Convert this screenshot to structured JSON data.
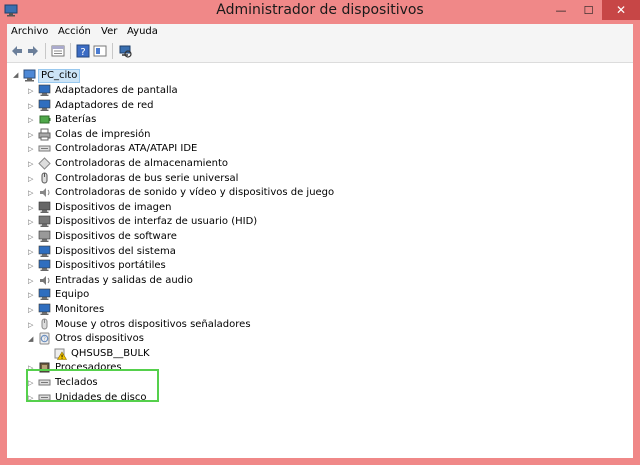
{
  "window": {
    "title": "Administrador de dispositivos",
    "close_glyph": "✕",
    "minimize_glyph": "—",
    "maximize_glyph": "☐"
  },
  "menubar": {
    "items": [
      "Archivo",
      "Acción",
      "Ver",
      "Ayuda"
    ]
  },
  "toolbar": {
    "buttons": [
      "back-icon",
      "forward-icon",
      "properties-view-icon",
      "help-icon",
      "show-hidden-icon",
      "scan-hardware-icon"
    ]
  },
  "tree": {
    "root": {
      "label": "PC_cito",
      "expanded": true
    },
    "categories": [
      {
        "label": "Adaptadores de pantalla",
        "icon": "display-adapter-icon"
      },
      {
        "label": "Adaptadores de red",
        "icon": "network-adapter-icon"
      },
      {
        "label": "Baterías",
        "icon": "battery-icon"
      },
      {
        "label": "Colas de impresión",
        "icon": "printer-icon"
      },
      {
        "label": "Controladoras ATA/ATAPI IDE",
        "icon": "ide-controller-icon"
      },
      {
        "label": "Controladoras de almacenamiento",
        "icon": "storage-controller-icon"
      },
      {
        "label": "Controladoras de bus serie universal",
        "icon": "usb-icon"
      },
      {
        "label": "Controladoras de sonido y vídeo y dispositivos de juego",
        "icon": "sound-icon"
      },
      {
        "label": "Dispositivos de imagen",
        "icon": "camera-icon"
      },
      {
        "label": "Dispositivos de interfaz de usuario (HID)",
        "icon": "hid-icon"
      },
      {
        "label": "Dispositivos de software",
        "icon": "software-device-icon"
      },
      {
        "label": "Dispositivos del sistema",
        "icon": "system-device-icon"
      },
      {
        "label": "Dispositivos portátiles",
        "icon": "portable-device-icon"
      },
      {
        "label": "Entradas y salidas de audio",
        "icon": "audio-io-icon"
      },
      {
        "label": "Equipo",
        "icon": "computer-icon"
      },
      {
        "label": "Monitores",
        "icon": "monitor-icon"
      },
      {
        "label": "Mouse y otros dispositivos señaladores",
        "icon": "mouse-icon"
      },
      {
        "label": "Otros dispositivos",
        "icon": "other-devices-icon",
        "expanded": true,
        "children": [
          {
            "label": "QHSUSB__BULK",
            "icon": "warning-device-icon"
          }
        ]
      },
      {
        "label": "Procesadores",
        "icon": "processor-icon"
      },
      {
        "label": "Teclados",
        "icon": "keyboard-icon"
      },
      {
        "label": "Unidades de disco",
        "icon": "disk-drive-icon"
      }
    ]
  },
  "colors": {
    "title_bar": "#f08888",
    "highlight_border": "#55d04c",
    "selection": "#cce4f7"
  }
}
